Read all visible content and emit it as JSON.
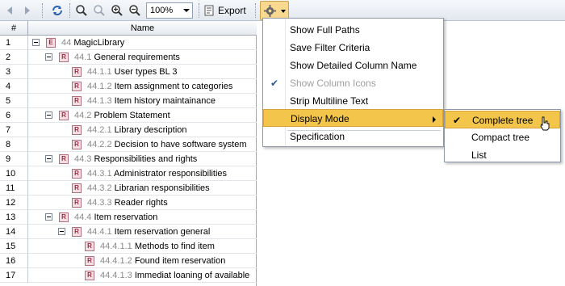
{
  "toolbar": {
    "zoom_value": "100%",
    "export_label": "Export",
    "icons": [
      "back-arrow-icon",
      "forward-arrow-icon",
      "refresh-icon",
      "zoom-fit-icon",
      "zoom-actual-icon",
      "zoom-in-icon",
      "zoom-out-icon",
      "export-icon",
      "gear-icon"
    ]
  },
  "table": {
    "headers": [
      "#",
      "Name"
    ],
    "rows": [
      {
        "num": "1",
        "id": "44",
        "label": "MagicLibrary",
        "type": "E"
      },
      {
        "num": "2",
        "id": "44.1",
        "label": "General requirements",
        "type": "R"
      },
      {
        "num": "3",
        "id": "44.1.1",
        "label": "User types BL 3",
        "type": "R"
      },
      {
        "num": "4",
        "id": "44.1.2",
        "label": "Item assignment to categories",
        "type": "R"
      },
      {
        "num": "5",
        "id": "44.1.3",
        "label": "Item history maintainance",
        "type": "R"
      },
      {
        "num": "6",
        "id": "44.2",
        "label": "Problem Statement",
        "type": "R"
      },
      {
        "num": "7",
        "id": "44.2.1",
        "label": "Library description",
        "type": "R"
      },
      {
        "num": "8",
        "id": "44.2.2",
        "label": "Decision to have software system",
        "type": "R"
      },
      {
        "num": "9",
        "id": "44.3",
        "label": "Responsibilities and rights",
        "type": "R"
      },
      {
        "num": "10",
        "id": "44.3.1",
        "label": "Administrator responsibilities",
        "type": "R"
      },
      {
        "num": "11",
        "id": "44.3.2",
        "label": "Librarian responsibilities",
        "type": "R"
      },
      {
        "num": "12",
        "id": "44.3.3",
        "label": "Reader rights",
        "type": "R"
      },
      {
        "num": "13",
        "id": "44.4",
        "label": "Item reservation",
        "type": "R"
      },
      {
        "num": "14",
        "id": "44.4.1",
        "label": "Item reservation general",
        "type": "R"
      },
      {
        "num": "15",
        "id": "44.4.1.1",
        "label": "Methods to find item",
        "type": "R"
      },
      {
        "num": "16",
        "id": "44.4.1.2",
        "label": "Found item reservation",
        "type": "R"
      },
      {
        "num": "17",
        "id": "44.4.1.3",
        "label": "Immediat loaning of available",
        "type": "R"
      }
    ]
  },
  "menu": {
    "items": [
      {
        "label": "Show Full Paths"
      },
      {
        "label": "Save Filter Criteria"
      },
      {
        "label": "Show Detailed Column Name"
      },
      {
        "label": "Show Column Icons"
      },
      {
        "label": "Strip Multiline Text"
      },
      {
        "label": "Display Mode"
      },
      {
        "label": "Specification"
      }
    ],
    "checkmark": "✔"
  },
  "submenu": {
    "items": [
      {
        "label": "Complete tree"
      },
      {
        "label": "Compact tree"
      },
      {
        "label": "List"
      }
    ]
  },
  "colors": {
    "accent": "#f3c64b",
    "requirement_icon": "#9b2c3e"
  }
}
